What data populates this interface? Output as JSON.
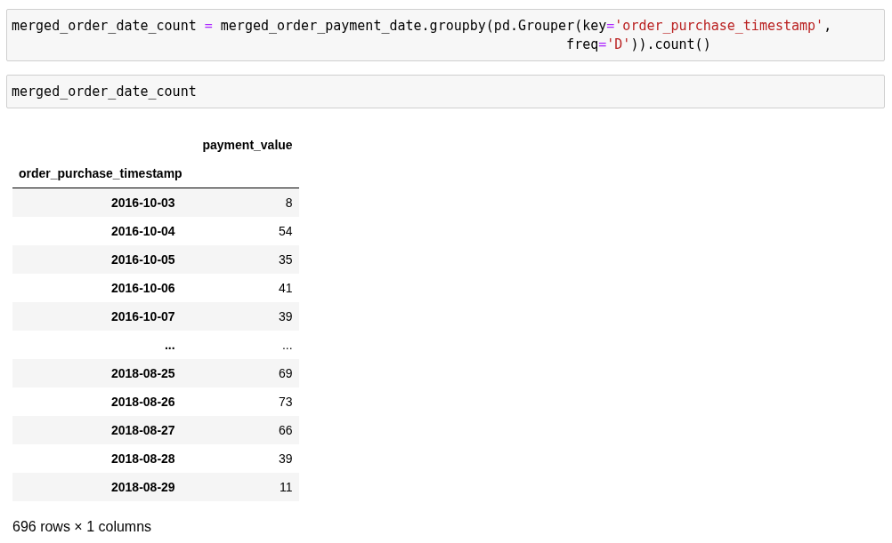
{
  "cells": [
    {
      "code_lines": [
        [
          {
            "kind": "plain",
            "text": "merged_order_date_count "
          },
          {
            "kind": "operator",
            "text": "="
          },
          {
            "kind": "plain",
            "text": " merged_order_payment_date.groupby(pd.Grouper(key"
          },
          {
            "kind": "operator",
            "text": "="
          },
          {
            "kind": "string",
            "text": "'order_purchase_timestamp'"
          },
          {
            "kind": "plain",
            "text": ","
          }
        ],
        [
          {
            "kind": "plain",
            "text": "                                                                     freq"
          },
          {
            "kind": "operator",
            "text": "="
          },
          {
            "kind": "string",
            "text": "'D'"
          },
          {
            "kind": "plain",
            "text": ")).count()"
          }
        ]
      ]
    },
    {
      "code_lines": [
        [
          {
            "kind": "plain",
            "text": "merged_order_date_count"
          }
        ]
      ]
    }
  ],
  "output": {
    "table": {
      "columns": [
        "payment_value"
      ],
      "index_name": "order_purchase_timestamp",
      "rows": [
        {
          "index": "2016-10-03",
          "values": [
            "8"
          ]
        },
        {
          "index": "2016-10-04",
          "values": [
            "54"
          ]
        },
        {
          "index": "2016-10-05",
          "values": [
            "35"
          ]
        },
        {
          "index": "2016-10-06",
          "values": [
            "41"
          ]
        },
        {
          "index": "2016-10-07",
          "values": [
            "39"
          ]
        },
        {
          "index": "...",
          "values": [
            "..."
          ]
        },
        {
          "index": "2018-08-25",
          "values": [
            "69"
          ]
        },
        {
          "index": "2018-08-26",
          "values": [
            "73"
          ]
        },
        {
          "index": "2018-08-27",
          "values": [
            "66"
          ]
        },
        {
          "index": "2018-08-28",
          "values": [
            "39"
          ]
        },
        {
          "index": "2018-08-29",
          "values": [
            "11"
          ]
        }
      ]
    },
    "shape": "696 rows × 1 columns"
  }
}
